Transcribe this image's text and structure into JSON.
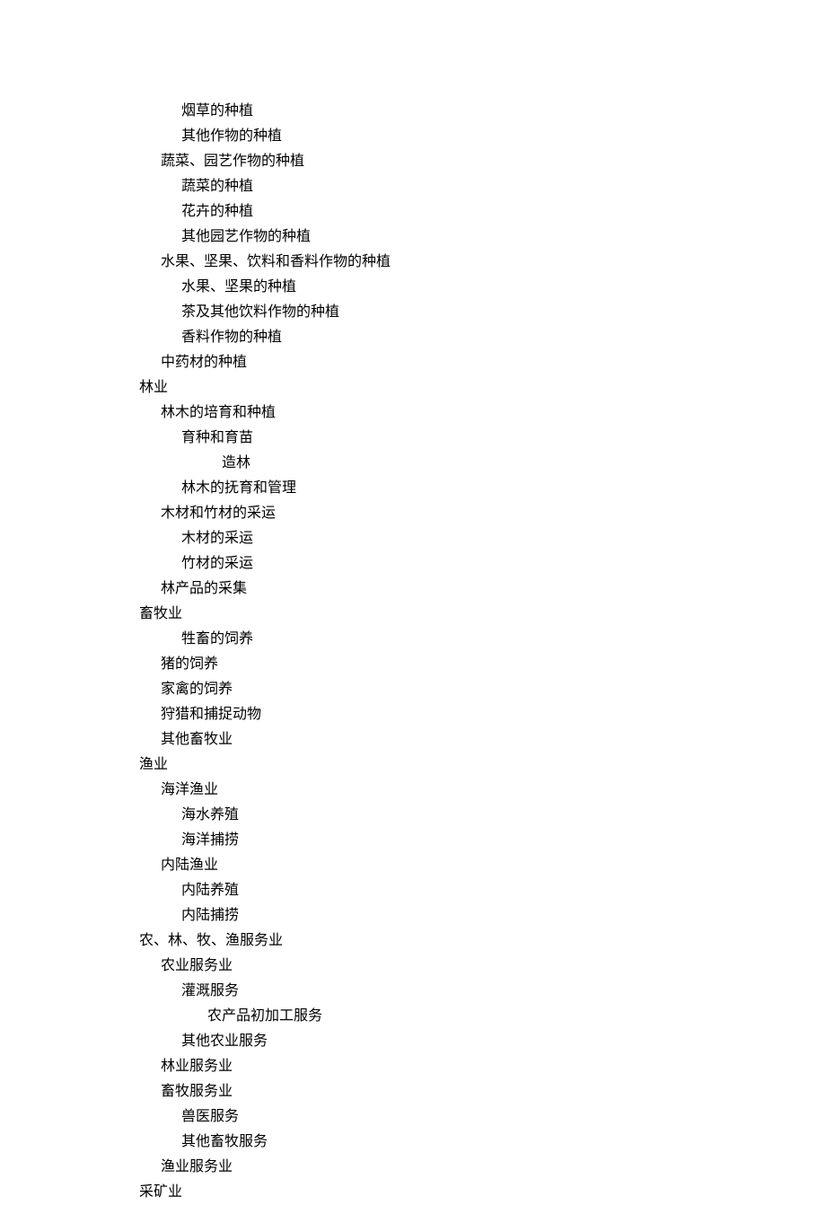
{
  "items": [
    {
      "level": "3",
      "text": "烟草的种植"
    },
    {
      "level": "3",
      "text": "其他作物的种植"
    },
    {
      "level": "2",
      "text": "蔬菜、园艺作物的种植"
    },
    {
      "level": "3",
      "text": "蔬菜的种植"
    },
    {
      "level": "3",
      "text": "花卉的种植"
    },
    {
      "level": "3",
      "text": "其他园艺作物的种植"
    },
    {
      "level": "2",
      "text": "水果、坚果、饮料和香料作物的种植"
    },
    {
      "level": "3",
      "text": "水果、坚果的种植"
    },
    {
      "level": "3",
      "text": "茶及其他饮料作物的种植"
    },
    {
      "level": "3",
      "text": "香料作物的种植"
    },
    {
      "level": "2",
      "text": "中药材的种植"
    },
    {
      "level": "1",
      "text": "林业"
    },
    {
      "level": "2",
      "text": "林木的培育和种植"
    },
    {
      "level": "3",
      "text": "育种和育苗"
    },
    {
      "level": "4",
      "text": "造林"
    },
    {
      "level": "3",
      "text": "林木的抚育和管理"
    },
    {
      "level": "2",
      "text": "木材和竹材的采运"
    },
    {
      "level": "3",
      "text": "木材的采运"
    },
    {
      "level": "3",
      "text": "竹材的采运"
    },
    {
      "level": "2",
      "text": "林产品的采集"
    },
    {
      "level": "1",
      "text": "畜牧业"
    },
    {
      "level": "3",
      "text": "牲畜的饲养"
    },
    {
      "level": "2",
      "text": "猪的饲养"
    },
    {
      "level": "2",
      "text": "家禽的饲养"
    },
    {
      "level": "2",
      "text": "狩猎和捕捉动物"
    },
    {
      "level": "2",
      "text": "其他畜牧业"
    },
    {
      "level": "1",
      "text": "渔业"
    },
    {
      "level": "2",
      "text": "海洋渔业"
    },
    {
      "level": "3",
      "text": "海水养殖"
    },
    {
      "level": "3",
      "text": "海洋捕捞"
    },
    {
      "level": "2",
      "text": "内陆渔业"
    },
    {
      "level": "3",
      "text": "内陆养殖"
    },
    {
      "level": "3",
      "text": "内陆捕捞"
    },
    {
      "level": "1",
      "text": "农、林、牧、渔服务业"
    },
    {
      "level": "2",
      "text": "农业服务业"
    },
    {
      "level": "3",
      "text": "灌溉服务"
    },
    {
      "level": "4b",
      "text": "农产品初加工服务"
    },
    {
      "level": "3",
      "text": "其他农业服务"
    },
    {
      "level": "2",
      "text": "林业服务业"
    },
    {
      "level": "2",
      "text": "畜牧服务业"
    },
    {
      "level": "3",
      "text": "兽医服务"
    },
    {
      "level": "3",
      "text": "其他畜牧服务"
    },
    {
      "level": "2",
      "text": "渔业服务业"
    },
    {
      "level": "1",
      "text": "采矿业"
    }
  ]
}
